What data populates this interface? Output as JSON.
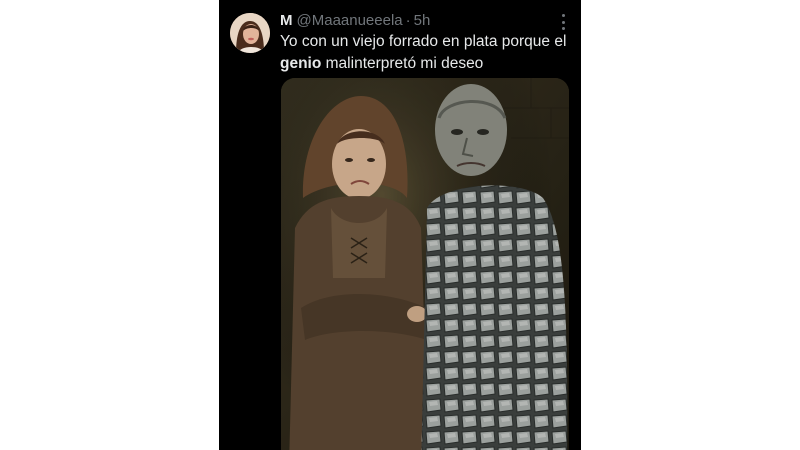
{
  "tweet": {
    "author_name": "M",
    "handle": "@Maaanueeela",
    "separator": "·",
    "time": "5h",
    "text_part1": "Yo con un viejo forrado en plata porque el ",
    "text_bold": "genio",
    "text_part2": " malinterpretó mi deseo"
  },
  "icons": {
    "more": "more-vertical-icon",
    "avatar": "profile-avatar"
  },
  "colors": {
    "background": "#000000",
    "primary_text": "#e7e9ea",
    "secondary_text": "#71767b"
  }
}
